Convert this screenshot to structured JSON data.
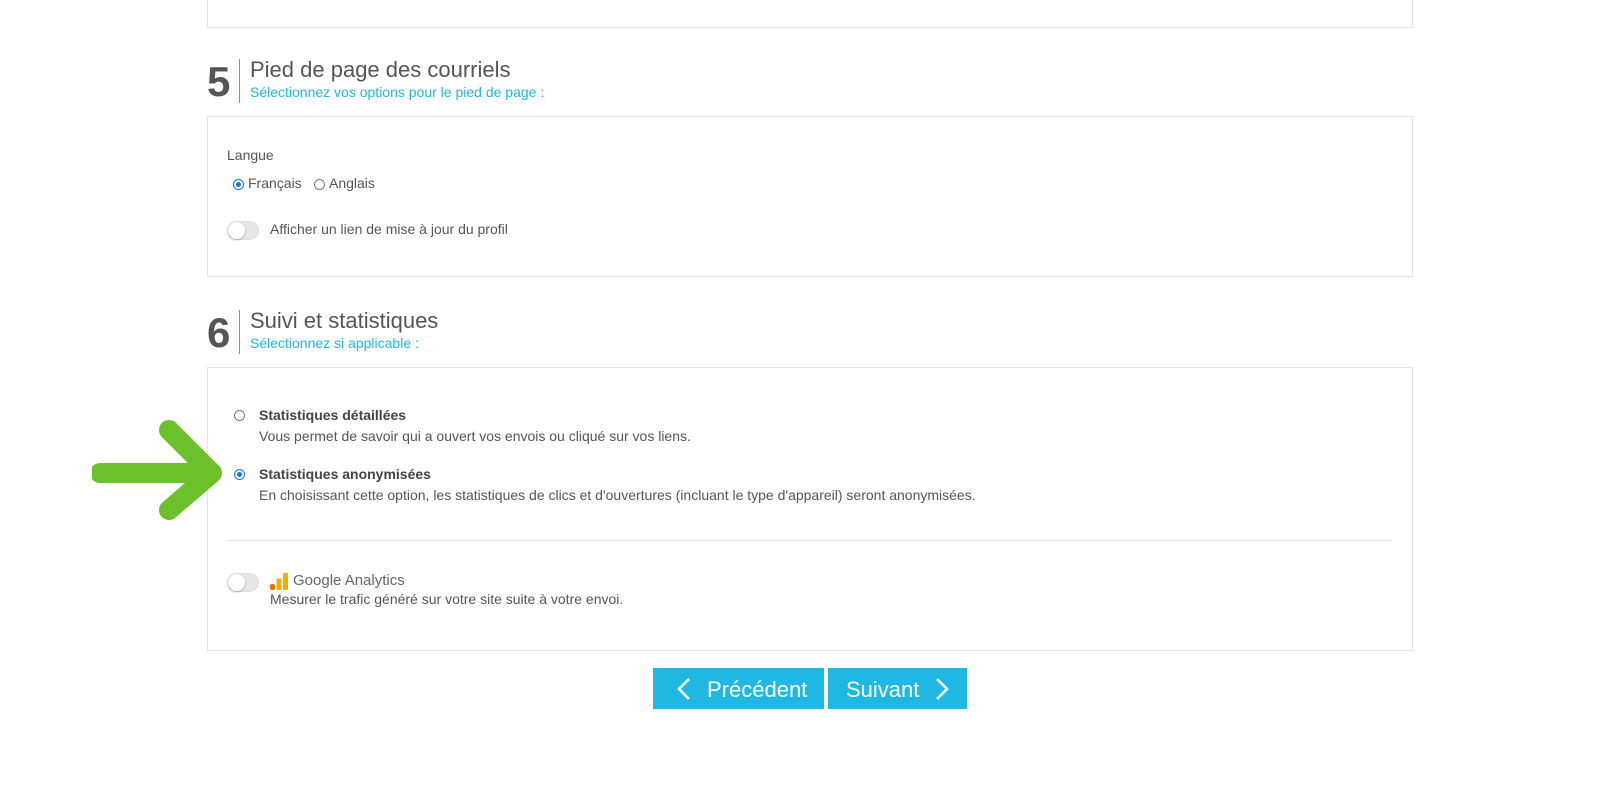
{
  "section5": {
    "number": "5",
    "title": "Pied de page des courriels",
    "subtitle": "Sélectionnez vos options pour le pied de page :",
    "language_label": "Langue",
    "languages": [
      "Français",
      "Anglais"
    ],
    "selected_language": "Français",
    "profile_link_toggle_label": "Afficher un lien de mise à jour du profil",
    "profile_link_enabled": false
  },
  "section6": {
    "number": "6",
    "title": "Suivi et statistiques",
    "subtitle": "Sélectionnez si applicable :",
    "options": [
      {
        "title": "Statistiques détaillées",
        "description": "Vous permet de savoir qui a ouvert vos envois ou cliqué sur vos liens.",
        "selected": false
      },
      {
        "title": "Statistiques anonymisées",
        "description": "En choisissant cette option, les statistiques de clics et d'ouvertures (incluant le type d'appareil) seront anonymisées.",
        "selected": true
      }
    ],
    "google_analytics": {
      "brand_text": "Google Analytics",
      "description": "Mesurer le trafic généré sur votre site suite à votre envoi.",
      "enabled": false
    }
  },
  "navigation": {
    "previous_label": "Précédent",
    "next_label": "Suivant"
  },
  "colors": {
    "accent": "#1eb8e3",
    "arrow": "#6cc02a",
    "radio_checked": "#1a73e8",
    "ga_orange": "#f9ab00",
    "ga_dark_orange": "#e37400"
  }
}
